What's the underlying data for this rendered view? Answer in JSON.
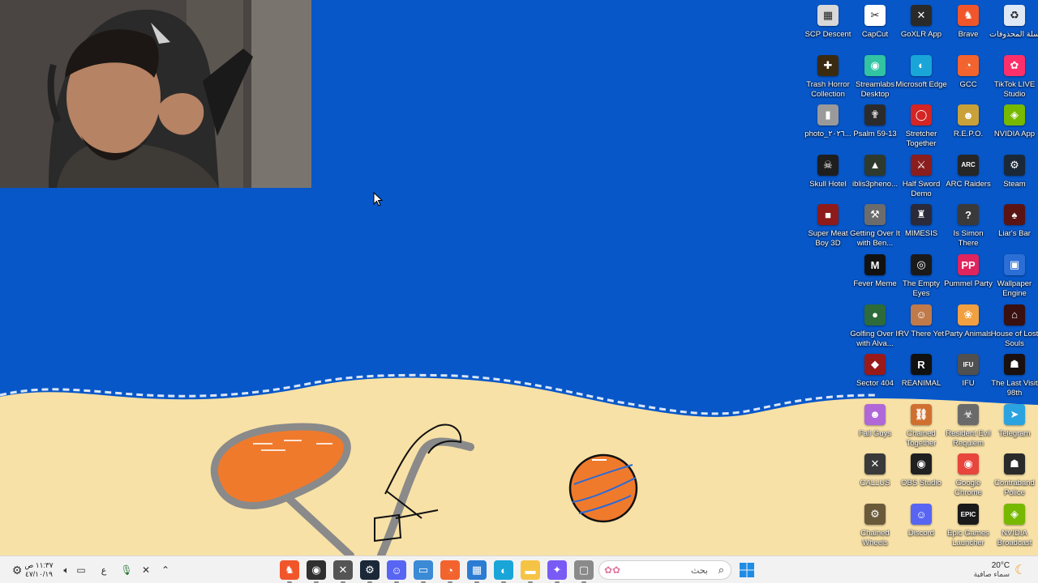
{
  "desktop": {
    "icons": [
      {
        "label": "SCP Descent",
        "icon": "scp-descent-icon",
        "color": "#d8d8d8",
        "glyph": "▦",
        "col": 0,
        "row": 0
      },
      {
        "label": "CapCut",
        "icon": "capcut-icon",
        "color": "#ffffff",
        "glyph": "✂",
        "col": 1,
        "row": 0
      },
      {
        "label": "GoXLR App",
        "icon": "goxlr-icon",
        "color": "#2a2a2a",
        "glyph": "✕",
        "col": 2,
        "row": 0
      },
      {
        "label": "Brave",
        "icon": "brave-icon",
        "color": "#f1562b",
        "glyph": "♞",
        "col": 3,
        "row": 0
      },
      {
        "label": "سلة المحذوفات",
        "icon": "recycle-bin-icon",
        "color": "#dfe9f5",
        "glyph": "♻",
        "col": 4,
        "row": 0
      },
      {
        "label": "Trash Horror Collection",
        "icon": "trash-horror-collection-icon",
        "color": "#3a2a10",
        "glyph": "✚",
        "col": 0,
        "row": 1
      },
      {
        "label": "Streamlabs Desktop",
        "icon": "streamlabs-icon",
        "color": "#31c3a2",
        "glyph": "◉",
        "col": 1,
        "row": 1
      },
      {
        "label": "Microsoft Edge",
        "icon": "edge-icon",
        "color": "#1aa5d8",
        "glyph": "◐",
        "col": 2,
        "row": 1
      },
      {
        "label": "GCC",
        "icon": "gcc-icon",
        "color": "#f2632d",
        "glyph": "◔",
        "col": 3,
        "row": 1
      },
      {
        "label": "TikTok LIVE Studio",
        "icon": "tiktok-live-icon",
        "color": "#ff2f6b",
        "glyph": "✿",
        "col": 4,
        "row": 1
      },
      {
        "label": "photo_٢٠٢٦...",
        "icon": "photo-file-icon",
        "color": "#9a9a9a",
        "glyph": "▮",
        "col": 0,
        "row": 2
      },
      {
        "label": "Psalm 59-13",
        "icon": "psalm-icon",
        "color": "#2b2b2b",
        "glyph": "✟",
        "col": 1,
        "row": 2
      },
      {
        "label": "Stretcher Together",
        "icon": "stretcher-together-icon",
        "color": "#d42424",
        "glyph": "◯",
        "col": 2,
        "row": 2
      },
      {
        "label": "R.E.P.O.",
        "icon": "repo-icon",
        "color": "#c9a13a",
        "glyph": "☻",
        "col": 3,
        "row": 2
      },
      {
        "label": "NVIDIA App",
        "icon": "nvidia-app-icon",
        "color": "#76b900",
        "glyph": "◈",
        "col": 4,
        "row": 2
      },
      {
        "label": "Skull Hotel",
        "icon": "skull-hotel-icon",
        "color": "#1e1e1e",
        "glyph": "☠",
        "col": 0,
        "row": 3
      },
      {
        "label": "iblis3pheno...",
        "icon": "iblis-icon",
        "color": "#2e3a2e",
        "glyph": "▲",
        "col": 1,
        "row": 3
      },
      {
        "label": "Half Sword Demo",
        "icon": "half-sword-icon",
        "color": "#8a1d1d",
        "glyph": "⚔",
        "col": 2,
        "row": 3
      },
      {
        "label": "ARC Raiders",
        "icon": "arc-raiders-icon",
        "color": "#262626",
        "glyph": "ARC",
        "col": 3,
        "row": 3
      },
      {
        "label": "Steam",
        "icon": "steam-icon",
        "color": "#1b2838",
        "glyph": "⚙",
        "col": 4,
        "row": 3
      },
      {
        "label": "Super Meat Boy 3D",
        "icon": "super-meat-boy-icon",
        "color": "#8e1a1a",
        "glyph": "■",
        "col": 0,
        "row": 4
      },
      {
        "label": "Getting Over It with Ben...",
        "icon": "getting-over-it-icon",
        "color": "#6c6c6c",
        "glyph": "⚒",
        "col": 1,
        "row": 4
      },
      {
        "label": "MIMESIS",
        "icon": "mimesis-icon",
        "color": "#2a2a3a",
        "glyph": "♜",
        "col": 2,
        "row": 4
      },
      {
        "label": "Is Simon There",
        "icon": "is-simon-there-icon",
        "color": "#3a3a3a",
        "glyph": "?",
        "col": 3,
        "row": 4
      },
      {
        "label": "Liar's Bar",
        "icon": "liars-bar-icon",
        "color": "#5a1414",
        "glyph": "♠",
        "col": 4,
        "row": 4
      },
      {
        "label": "Fever Meme",
        "icon": "fever-meme-icon",
        "color": "#111111",
        "glyph": "M",
        "col": 1,
        "row": 5
      },
      {
        "label": "The Empty Eyes",
        "icon": "empty-eyes-icon",
        "color": "#1a1a1a",
        "glyph": "◎",
        "col": 2,
        "row": 5
      },
      {
        "label": "Pummel Party",
        "icon": "pummel-party-icon",
        "color": "#e0245e",
        "glyph": "PP",
        "col": 3,
        "row": 5
      },
      {
        "label": "Wallpaper Engine",
        "icon": "wallpaper-engine-icon",
        "color": "#2b6fd6",
        "glyph": "▣",
        "col": 4,
        "row": 5
      },
      {
        "label": "Golfing Over It with Alva...",
        "icon": "golfing-over-it-icon",
        "color": "#2d6b3a",
        "glyph": "●",
        "col": 1,
        "row": 6
      },
      {
        "label": "RV There Yet",
        "icon": "rv-there-yet-icon",
        "color": "#c07a4a",
        "glyph": "☺",
        "col": 2,
        "row": 6
      },
      {
        "label": "Party Animals",
        "icon": "party-animals-icon",
        "color": "#f0a040",
        "glyph": "❀",
        "col": 3,
        "row": 6
      },
      {
        "label": "House of Lost Souls",
        "icon": "house-of-lost-souls-icon",
        "color": "#3a1010",
        "glyph": "⌂",
        "col": 4,
        "row": 6
      },
      {
        "label": "Sector 404",
        "icon": "sector-404-icon",
        "color": "#9a1a1a",
        "glyph": "◆",
        "col": 1,
        "row": 7
      },
      {
        "label": "REANIMAL",
        "icon": "reanimal-icon",
        "color": "#111111",
        "glyph": "R",
        "col": 2,
        "row": 7
      },
      {
        "label": "IFU",
        "icon": "ifu-icon",
        "color": "#505050",
        "glyph": "IFU",
        "col": 3,
        "row": 7
      },
      {
        "label": "The Last Visit 98th",
        "icon": "last-visit-icon",
        "color": "#1a1010",
        "glyph": "☗",
        "col": 4,
        "row": 7
      },
      {
        "label": "Fall Guys",
        "icon": "fall-guys-icon",
        "color": "#b067d8",
        "glyph": "☻",
        "col": 1,
        "row": 8
      },
      {
        "label": "Chained Together",
        "icon": "chained-together-icon",
        "color": "#d07030",
        "glyph": "⛓",
        "col": 2,
        "row": 8
      },
      {
        "label": "Resident Evil Requiem",
        "icon": "resident-evil-icon",
        "color": "#6a6a6a",
        "glyph": "☣",
        "col": 3,
        "row": 8
      },
      {
        "label": "Telegram",
        "icon": "telegram-icon",
        "color": "#2aa3e0",
        "glyph": "➤",
        "col": 4,
        "row": 8
      },
      {
        "label": "CALLUS",
        "icon": "callus-icon",
        "color": "#3a3a3a",
        "glyph": "✕",
        "col": 1,
        "row": 9
      },
      {
        "label": "OBS Studio",
        "icon": "obs-studio-icon",
        "color": "#202020",
        "glyph": "◉",
        "col": 2,
        "row": 9
      },
      {
        "label": "Google Chrome",
        "icon": "chrome-icon",
        "color": "#e8453c",
        "glyph": "◉",
        "col": 3,
        "row": 9
      },
      {
        "label": "Contraband Police",
        "icon": "contraband-police-icon",
        "color": "#2a2a2a",
        "glyph": "☗",
        "col": 4,
        "row": 9
      },
      {
        "label": "Chained Wheels",
        "icon": "chained-wheels-icon",
        "color": "#6a5a3a",
        "glyph": "⚙",
        "col": 1,
        "row": 10
      },
      {
        "label": "Discord",
        "icon": "discord-icon",
        "color": "#5865f2",
        "glyph": "☺",
        "col": 2,
        "row": 10
      },
      {
        "label": "Epic Games Launcher",
        "icon": "epic-games-icon",
        "color": "#1a1a1a",
        "glyph": "EPIC",
        "col": 3,
        "row": 10
      },
      {
        "label": "NVIDIA Broadcast",
        "icon": "nvidia-broadcast-icon",
        "color": "#76b900",
        "glyph": "◈",
        "col": 4,
        "row": 10
      }
    ]
  },
  "taskbar": {
    "clock_time": "١١:٣٧ ص",
    "clock_date": "٤٧/١٠/١٩",
    "language": "ع",
    "search_placeholder": "بحث",
    "weather_temp": "20°C",
    "weather_desc": "سماء صافية",
    "apps": [
      {
        "name": "brave",
        "icon": "brave-icon",
        "color": "#f1562b",
        "glyph": "♞"
      },
      {
        "name": "obs",
        "icon": "obs-studio-icon",
        "color": "#303030",
        "glyph": "◉"
      },
      {
        "name": "goxlr",
        "icon": "goxlr-icon",
        "color": "#555555",
        "glyph": "✕"
      },
      {
        "name": "steam",
        "icon": "steam-icon",
        "color": "#1b2838",
        "glyph": "⚙"
      },
      {
        "name": "discord",
        "icon": "discord-icon",
        "color": "#5865f2",
        "glyph": "☺"
      },
      {
        "name": "remote-desktop",
        "icon": "remote-desktop-icon",
        "color": "#3a8ad6",
        "glyph": "▭"
      },
      {
        "name": "gcc",
        "icon": "gcc-icon",
        "color": "#f2632d",
        "glyph": "◔"
      },
      {
        "name": "store",
        "icon": "microsoft-store-icon",
        "color": "#2b7cd3",
        "glyph": "▦"
      },
      {
        "name": "edge",
        "icon": "edge-icon",
        "color": "#1aa5d8",
        "glyph": "◐"
      },
      {
        "name": "file-explorer",
        "icon": "file-explorer-icon",
        "color": "#f6c445",
        "glyph": "▬"
      },
      {
        "name": "copilot",
        "icon": "copilot-icon",
        "color": "#7a5af5",
        "glyph": "✦"
      },
      {
        "name": "task-view",
        "icon": "task-view-icon",
        "color": "#8a8a8a",
        "glyph": "▢"
      }
    ]
  }
}
